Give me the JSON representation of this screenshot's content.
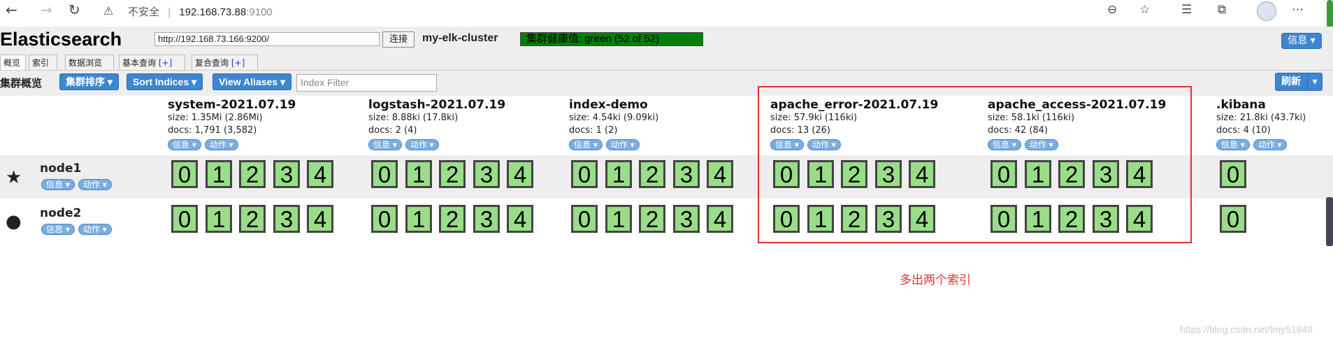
{
  "browser": {
    "back_icon": "back-arrow-icon",
    "security_text": "不安全",
    "separator": "|",
    "host": "192.168.73.88",
    "port": ":9100"
  },
  "app": {
    "logo": "Elasticsearch",
    "cluster_url": "http://192.168.73.166:9200/",
    "connect_label": "连接",
    "cluster_name": "my-elk-cluster",
    "health": "集群健康值: green (52 of 52)",
    "info_label": "信息 ▾",
    "health_color": "#008000",
    "accent": "#3f86d1"
  },
  "tabs": [
    {
      "label": "概览"
    },
    {
      "label": "索引"
    },
    {
      "label": "数据浏览"
    },
    {
      "label": "基本查询",
      "plus": "[+]"
    },
    {
      "label": "复合查询",
      "plus": "[+]"
    }
  ],
  "toolbar": {
    "title": "集群概览",
    "sort_cluster": "集群排序 ▾",
    "sort_indices": "Sort Indices ▾",
    "view_aliases": "View Aliases ▾",
    "filter_placeholder": "Index Filter",
    "refresh": "刷新",
    "refresh_arrow": "▾"
  },
  "pills": {
    "info": "信息 ▾",
    "action": "动作 ▾"
  },
  "indices": [
    {
      "name": "system-2021.07.19",
      "size": "size: 1.35Mi (2.86Mi)",
      "docs": "docs: 1,791 (3,582)",
      "shards": [
        "0",
        "1",
        "2",
        "3",
        "4"
      ]
    },
    {
      "name": "logstash-2021.07.19",
      "size": "size: 8.88ki (17.8ki)",
      "docs": "docs: 2 (4)",
      "shards": [
        "0",
        "1",
        "2",
        "3",
        "4"
      ]
    },
    {
      "name": "index-demo",
      "size": "size: 4.54ki (9.09ki)",
      "docs": "docs: 1 (2)",
      "shards": [
        "0",
        "1",
        "2",
        "3",
        "4"
      ]
    },
    {
      "name": "apache_error-2021.07.19",
      "size": "size: 57.9ki (116ki)",
      "docs": "docs: 13 (26)",
      "shards": [
        "0",
        "1",
        "2",
        "3",
        "4"
      ]
    },
    {
      "name": "apache_access-2021.07.19",
      "size": "size: 58.1ki (116ki)",
      "docs": "docs: 42 (84)",
      "shards": [
        "0",
        "1",
        "2",
        "3",
        "4"
      ]
    },
    {
      "name": ".kibana",
      "size": "size: 21.8ki (43.7ki)",
      "docs": "docs: 4 (10)",
      "shards": [
        "0"
      ]
    }
  ],
  "nodes": [
    {
      "name": "node1",
      "icon": "star-icon",
      "glyph": "★"
    },
    {
      "name": "node2",
      "icon": "circle-icon",
      "glyph": "●"
    }
  ],
  "annotation": "多出两个索引",
  "watermark": "https://blog.csdn.net/lmy51848"
}
